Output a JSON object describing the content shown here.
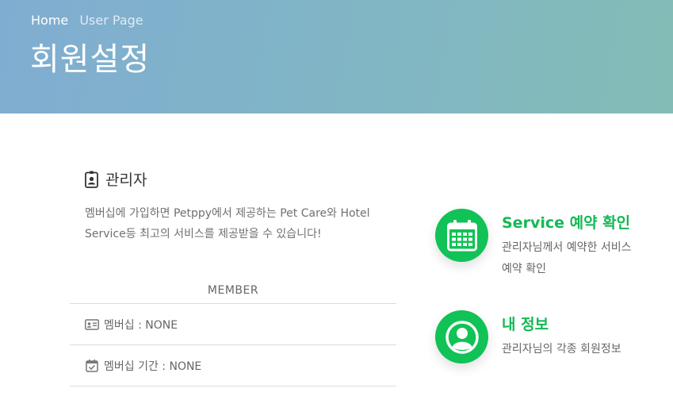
{
  "breadcrumb": {
    "home": "Home",
    "current": "User Page"
  },
  "page_title": "회원설정",
  "admin": {
    "title": "관리자",
    "description": "멤버십에 가입하면 Petppy에서 제공하는 Pet Care와 Hotel Service등 최고의 서비스를 제공받을 수 있습니다!",
    "member_label": "MEMBER",
    "membership": "멤버십 : NONE",
    "membership_period": "멤버십 기간 : NONE"
  },
  "services": [
    {
      "title": "Service 예약 확인",
      "desc_line1": "관리자님께서 예약한 서비스",
      "desc_line2": "예약 확인",
      "icon": "calendar-icon"
    },
    {
      "title": "내 정보",
      "desc_line1": "관리자님의 각종 회원정보",
      "icon": "user-circle-icon"
    }
  ],
  "colors": {
    "accent": "#11c256",
    "hero_start": "#7fadd2",
    "hero_end": "#83bcb6"
  }
}
